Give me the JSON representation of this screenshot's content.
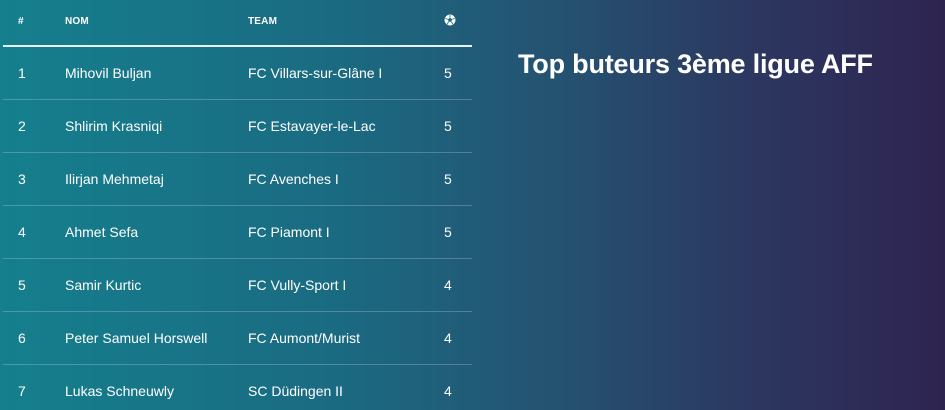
{
  "title": "Top buteurs 3ème ligue AFF",
  "table": {
    "headers": {
      "rank": "#",
      "name": "NOM",
      "team": "TEAM",
      "goals_icon": "soccer-ball-icon"
    },
    "rows": [
      {
        "rank": "1",
        "name": "Mihovil Buljan",
        "team": "FC Villars-sur-Glâne I",
        "goals": "5"
      },
      {
        "rank": "2",
        "name": "Shlirim Krasniqi",
        "team": "FC Estavayer-le-Lac",
        "goals": "5"
      },
      {
        "rank": "3",
        "name": "Ilirjan Mehmetaj",
        "team": "FC Avenches I",
        "goals": "5"
      },
      {
        "rank": "4",
        "name": "Ahmet Sefa",
        "team": "FC Piamont I",
        "goals": "5"
      },
      {
        "rank": "5",
        "name": "Samir Kurtic",
        "team": "FC Vully-Sport I",
        "goals": "4"
      },
      {
        "rank": "6",
        "name": "Peter Samuel Horswell",
        "team": "FC Aumont/Murist",
        "goals": "4"
      },
      {
        "rank": "7",
        "name": "Lukas Schneuwly",
        "team": "SC Düdingen II",
        "goals": "4"
      }
    ]
  },
  "colors": {
    "gradient_start": "#157f8d",
    "gradient_end": "#2e2450",
    "text": "#ffffff"
  }
}
